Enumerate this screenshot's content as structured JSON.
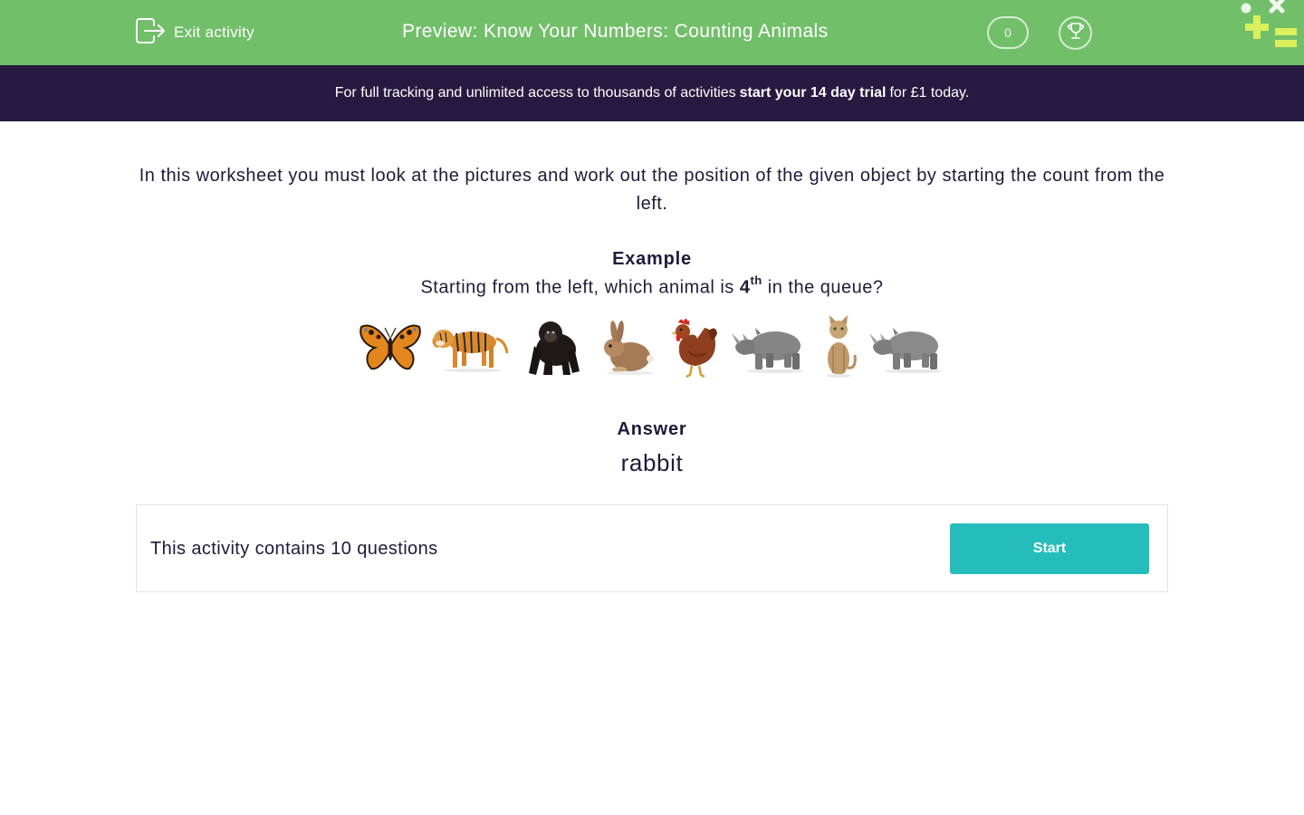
{
  "header": {
    "exit_label": "Exit activity",
    "title": "Preview: Know Your Numbers: Counting Animals",
    "score": "0"
  },
  "banner": {
    "text_before": "For full tracking and unlimited access to thousands of activities",
    "link_text": "start your 14 day trial",
    "text_after": "for £1 today."
  },
  "intro": "In this worksheet you must look at the pictures and work out the position of the given object by starting the count from the left.",
  "example": {
    "heading": "Example",
    "question_before": "Starting from the left, which animal is",
    "ordinal_number": "4",
    "ordinal_suffix": "th",
    "question_after": "in the queue?",
    "animals": [
      "butterfly",
      "tiger",
      "gorilla",
      "rabbit",
      "chicken",
      "rhino",
      "cat",
      "rhino"
    ]
  },
  "answer": {
    "heading": "Answer",
    "value": "rabbit"
  },
  "activity": {
    "summary": "This activity contains 10 questions",
    "start_label": "Start"
  },
  "colors": {
    "header_green": "#72bf6a",
    "banner_purple": "#261a40",
    "start_teal": "#24bdbc",
    "text_dark": "#1e1b3a"
  }
}
